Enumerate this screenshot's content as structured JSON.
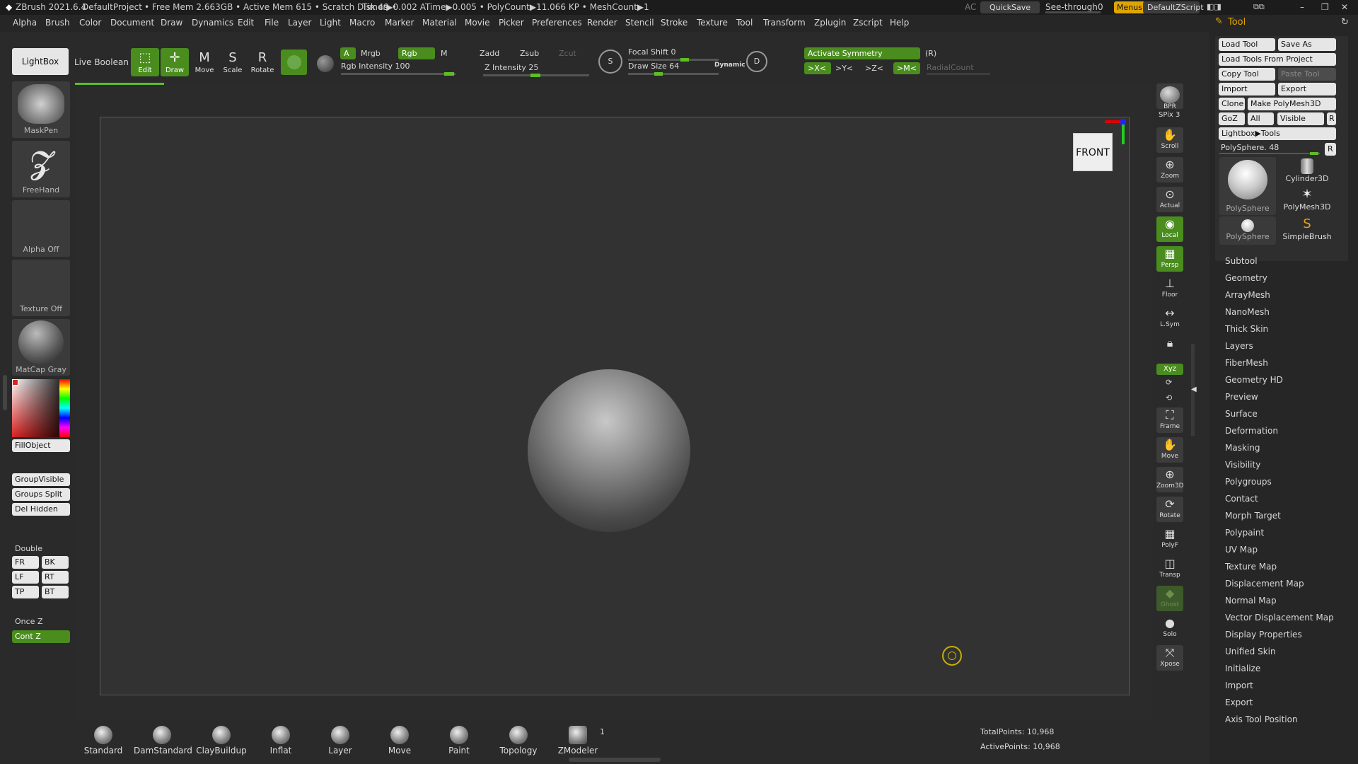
{
  "titlebar": {
    "app": "ZBrush 2021.6.4",
    "project": "DefaultProject",
    "stats": "• Free Mem 2.663GB • Active Mem 615 • Scratch Disk 49 •",
    "timer": "Timer▶0.002 ATime▶0.005 • PolyCount▶11.066 KP • MeshCount▶1",
    "ac": "AC",
    "quicksave": "QuickSave",
    "seethrough": "See-through",
    "seethrough_value": "0",
    "menus": "Menus",
    "script": "DefaultZScript"
  },
  "menubar": [
    "Alpha",
    "Brush",
    "Color",
    "Document",
    "Draw",
    "Dynamics",
    "Edit",
    "File",
    "Layer",
    "Light",
    "Macro",
    "Marker",
    "Material",
    "Movie",
    "Picker",
    "Preferences",
    "Render",
    "Stencil",
    "Stroke",
    "Texture",
    "Tool",
    "Transform",
    "Zplugin",
    "Zscript",
    "Help"
  ],
  "toolbar": {
    "lightbox": "LightBox",
    "live_boolean": "Live Boolean",
    "edit": "Edit",
    "draw": "Draw",
    "move": "Move",
    "scale": "Scale",
    "rotate": "Rotate",
    "a": "A",
    "mrgb": "Mrgb",
    "rgb": "Rgb",
    "m": "M",
    "rgb_intensity": "Rgb Intensity 100",
    "zadd": "Zadd",
    "zsub": "Zsub",
    "zcut": "Zcut",
    "z_intensity": "Z Intensity 25",
    "focal_shift": "Focal Shift 0",
    "draw_size": "Draw Size 64",
    "dynamic": "Dynamic",
    "activate_symmetry": "Activate Symmetry",
    "r_label": "(R)",
    "sym_x": ">X<",
    "sym_y": ">Y<",
    "sym_z": ">Z<",
    "sym_m": ">M<",
    "radial_count": "RadialCount"
  },
  "leftshelf": {
    "maskpen": "MaskPen",
    "freehand": "FreeHand",
    "alpha_off": "Alpha Off",
    "texture_off": "Texture Off",
    "matcap": "MatCap Gray",
    "fillobject": "FillObject",
    "groupvisible": "GroupVisible",
    "groups_split": "Groups Split",
    "del_hidden": "Del Hidden",
    "double": "Double",
    "fr": "FR",
    "bk": "BK",
    "lf": "LF",
    "rt": "RT",
    "tp": "TP",
    "bt": "BT",
    "once_z": "Once Z",
    "cont_z": "Cont Z"
  },
  "viewport": {
    "front_label": "FRONT"
  },
  "rightshelf": [
    "BPR",
    "SPix 3",
    "Scroll",
    "Zoom",
    "Actual",
    "Local",
    "Persp",
    "Floor",
    "L.Sym",
    "",
    "Xyz",
    "",
    "",
    "Frame",
    "Move",
    "Zoom3D",
    "Rotate",
    "PolyF",
    "Transp",
    "Ghost",
    "Solo",
    "Xpose"
  ],
  "bottom": {
    "brushes": [
      "Standard",
      "DamStandard",
      "ClayBuildup",
      "Inflat",
      "Layer",
      "Move",
      "Paint",
      "Topology",
      "ZModeler"
    ],
    "zmodeler_count": "1",
    "total_points": "TotalPoints: 10,968",
    "active_points": "ActivePoints: 10,968"
  },
  "palette": {
    "title": "Tool",
    "load_tool": "Load Tool",
    "save_as": "Save As",
    "load_from_project": "Load Tools From Project",
    "copy_tool": "Copy Tool",
    "paste_tool": "Paste Tool",
    "import": "Import",
    "export": "Export",
    "clone": "Clone",
    "make_polymesh": "Make PolyMesh3D",
    "goz": "GoZ",
    "all": "All",
    "visible": "Visible",
    "r": "R",
    "lightbox_tools": "Lightbox▶Tools",
    "polysphere_slider": "PolySphere. 48",
    "thumbs": [
      "PolySphere",
      "Cylinder3D",
      "PolyMesh3D",
      "PolySphere",
      "SimpleBrush"
    ],
    "subpalettes": [
      "Subtool",
      "Geometry",
      "ArrayMesh",
      "NanoMesh",
      "Thick Skin",
      "Layers",
      "FiberMesh",
      "Geometry HD",
      "Preview",
      "Surface",
      "Deformation",
      "Masking",
      "Visibility",
      "Polygroups",
      "Contact",
      "Morph Target",
      "Polypaint",
      "UV Map",
      "Texture Map",
      "Displacement Map",
      "Normal Map",
      "Vector Displacement Map",
      "Display Properties",
      "Unified Skin",
      "Initialize",
      "Import",
      "Export",
      "Axis Tool Position"
    ]
  },
  "colors": {
    "accent_green": "#4a8d1e",
    "bright_green": "#a4dc4a",
    "viewport_bg": "#323232"
  }
}
